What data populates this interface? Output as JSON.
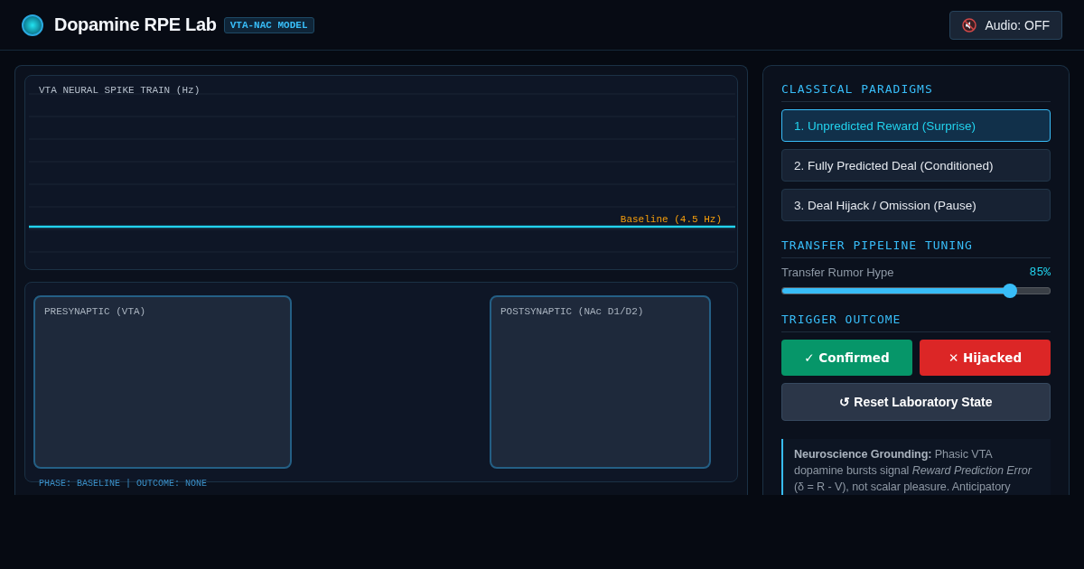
{
  "header": {
    "title": "Dopamine RPE Lab",
    "badge": "VTA-NAC MODEL",
    "audio": {
      "label": "Audio: OFF",
      "on": false
    }
  },
  "spike_chart": {
    "title": "VTA NEURAL SPIKE TRAIN (Hz)",
    "baseline_label": "Baseline (4.5 Hz)"
  },
  "synapse": {
    "presynaptic": "PRESYNAPTIC (VTA)",
    "postsynaptic": "POSTSYNAPTIC (NAc D1/D2)",
    "status": "PHASE: BASELINE | OUTCOME: NONE"
  },
  "paradigms": {
    "heading": "CLASSICAL PARADIGMS",
    "items": [
      {
        "label": "1. Unpredicted Reward (Surprise)",
        "selected": true
      },
      {
        "label": "2. Fully Predicted Deal (Conditioned)",
        "selected": false
      },
      {
        "label": "3. Deal Hijack / Omission (Pause)",
        "selected": false
      }
    ]
  },
  "tuning": {
    "heading": "TRANSFER PIPELINE TUNING",
    "slider": {
      "label": "Transfer Rumor Hype",
      "reading": "85%",
      "level": 0.85
    }
  },
  "outcome": {
    "heading": "TRIGGER OUTCOME",
    "buttons": [
      {
        "kind": "confirm",
        "label": "✓ Confirmed"
      },
      {
        "kind": "hijack",
        "label": "✕ Hijacked"
      },
      {
        "kind": "reset",
        "label": "↺ Reset Laboratory State"
      }
    ]
  },
  "note": "**Neuroscience Grounding:** Phasic VTA dopamine bursts signal *Reward Prediction Error* (δ = R - V), not scalar pleasure. Anticipatory"
}
